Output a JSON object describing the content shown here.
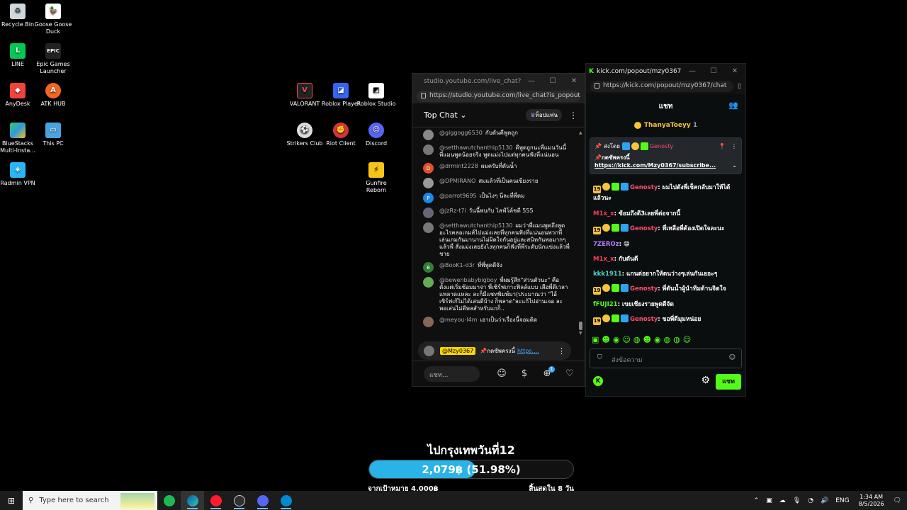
{
  "desktop": {
    "icons": [
      {
        "label": "Recycle Bin",
        "icon": "recycle-bin-icon"
      },
      {
        "label": "Goose Goose Duck",
        "icon": "goose-icon"
      },
      {
        "label": "LINE",
        "icon": "line-icon"
      },
      {
        "label": "Epic Games Launcher",
        "icon": "epic-icon"
      },
      {
        "label": "AnyDesk",
        "icon": "anydesk-icon"
      },
      {
        "label": "ATK HUB",
        "icon": "atk-icon"
      },
      {
        "label": "BlueStacks Multi-Insta...",
        "icon": "bluestacks-icon"
      },
      {
        "label": "This PC",
        "icon": "pc-icon"
      },
      {
        "label": "Radmin VPN",
        "icon": "radmin-icon"
      },
      {
        "label": "VALORANT",
        "icon": "valorant-icon"
      },
      {
        "label": "Roblox Player",
        "icon": "roblox-icon"
      },
      {
        "label": "Roblox Studio",
        "icon": "roblox-studio-icon"
      },
      {
        "label": "Strikers Club",
        "icon": "strikers-icon"
      },
      {
        "label": "Riot Client",
        "icon": "riot-icon"
      },
      {
        "label": "Discord",
        "icon": "discord-icon"
      },
      {
        "label": "Gunfire Reborn",
        "icon": "gunfire-icon"
      }
    ]
  },
  "youtube": {
    "window_title": "studio.youtube.com/live_chat?i...",
    "url": "https://studio.youtube.com/live_chat?is_popout...",
    "chat_mode": "Top Chat",
    "fan_label": "ท็อปแฟน",
    "messages": [
      {
        "user": "@giggogg6530",
        "text": "กับดันคืพูดถูก",
        "avatar": "#888"
      },
      {
        "user": "@setthawutchanthip5130",
        "text": "ดีพูดถูกนะพี่แมนวันนี้ พี่แมนพูดน้อยจริง พูดแม่งไปแต่ทุกคนฟังที่แน่นอน",
        "avatar": "#777"
      },
      {
        "user": "@drmint2228",
        "text": "ผมครับที่ดันน้ำ",
        "avatar": "#e1502b",
        "initial": "D"
      },
      {
        "user": "@DPMIRANO",
        "text": "สมแล้วที่เป็นคนเขียงราย",
        "avatar": "#999"
      },
      {
        "user": "@parrot9695",
        "text": "เป็นไงๆ นี่ละที่พี่ดม",
        "avatar": "#1e88e5",
        "initial": "P"
      },
      {
        "user": "@JzRz-t7i",
        "text": "วันนี้พบกับ ไลฟ์โค้ชดี 555",
        "avatar": "#667"
      },
      {
        "user": "@setthawutchanthip5130",
        "text": "ผมว่าพี่แมนพูดถึงพูดอะไรคลอเกมส์ไปแม่งเลยที่ทุกคนฟังที่แน่นอนพวกที่เล่นเกมกันมานานไม่ผิดใจกันอยู่และสนิทกันพอมากๆแล้วพี่ สั่งแม่งเลยยังไงทุกคนก็ฟังที่พี่ระดับนักแข่งแล้วพี่ชาย",
        "avatar": "#777"
      },
      {
        "user": "@BooK1-d3r",
        "text": "ที่พี่พูดดีจัง",
        "avatar": "#2e7d32",
        "initial": "B"
      },
      {
        "user": "@bewenbabybigboy",
        "text": "พี่ผมรู้สึก\"ส่วนตัวนะ\" คือตั้งแต่เริ่มซ้อมมาจ่า พี่เซิร์ฟเกาะฟิลล์แบบ เสือพี่ดีเวลาแพลาดแหละ ละก็มีแชทพิมพ์มา(ประมาณว่า \"ไอ้เซิร์ฟเก้ไม่ได้เล่นดีบ้าง ก็พลาด\"ละแก้ไปอ่านเจอ ละพอเล่นไม่ดีพลสำหรับแกก็..",
        "avatar": "#6a5"
      },
      {
        "user": "@meyou-l4m",
        "text": "เอาเป็นว่าเรื่องนี้จอมดิด",
        "avatar": "#865"
      }
    ],
    "pinned": {
      "mention": "@Mzy0367",
      "text": "📌กดซัพครงนี้",
      "link": "https...."
    },
    "input_placeholder": "แชท...",
    "badge_count": "1"
  },
  "kick": {
    "window_title": "kick.com/popout/mzy0367...",
    "url": "https://kick.com/popout/mzy0367/chat",
    "header": "แชท",
    "top_gifter": {
      "name": "ThanyaToeyy",
      "count": "1"
    },
    "pin": {
      "by_label": "ส่งโดย",
      "user": "Genosty",
      "text": "📌กดซัพครงนี้",
      "link": "https://kick.com/Mzy0367/subscribe..."
    },
    "messages": [
      {
        "user": "Genosty",
        "color": "#ff4d6d",
        "text": "ผมไปดังพี่เช็คกลับมาให้ได้แล้วนะ",
        "badges": true
      },
      {
        "user": "M1x_x",
        "color": "#ff3b5c",
        "text": "ซ้อมถึงตี3เลยพี่ต่อจากนี้",
        "badges": false
      },
      {
        "user": "Genosty",
        "color": "#ff4d6d",
        "text": "ที่เหลือพี่ต้องเปิดใจละนะ",
        "badges": true
      },
      {
        "user": "7ZEROz",
        "color": "#b57bff",
        "text": "😁",
        "badges": false
      },
      {
        "user": "M1x_x",
        "color": "#ff3b5c",
        "text": "กับดันดี",
        "badges": false
      },
      {
        "user": "kkk1911",
        "color": "#4fd1c5",
        "text": "แกนต่อยากให้ดนว่างๆเล่นกันเยอะๆ",
        "badges": false
      },
      {
        "user": "Genosty",
        "color": "#ff4d6d",
        "text": "พี่ดันน้ำผู้นำทีมด้านจิตใจ",
        "badges": true
      },
      {
        "user": "fFUJI21",
        "color": "#53fc18",
        "text": "เขยเชียงรายพูดดีจัด",
        "badges": false
      },
      {
        "user": "Genosty",
        "color": "#ff4d6d",
        "text": "ขอพี่ดีมุมหน่อย",
        "badges": true
      }
    ],
    "emotes": "▣☻◉☺◍☻◉◍◍☺",
    "input_placeholder": "ส่งข้อความ",
    "send_label": "แชท"
  },
  "goal": {
    "title": "ไปกรุงเทพวันที่12",
    "progress_text": "2,079฿ (51.98%)",
    "fraction": 0.5198,
    "target": "จากเป้าหมาย 4,000฿",
    "remaining": "สิ้นสุดใน 8 วัน"
  },
  "taskbar": {
    "search_placeholder": "Type here to search",
    "language": "ENG",
    "time": "1:34 AM",
    "date": "8/5/2026"
  }
}
